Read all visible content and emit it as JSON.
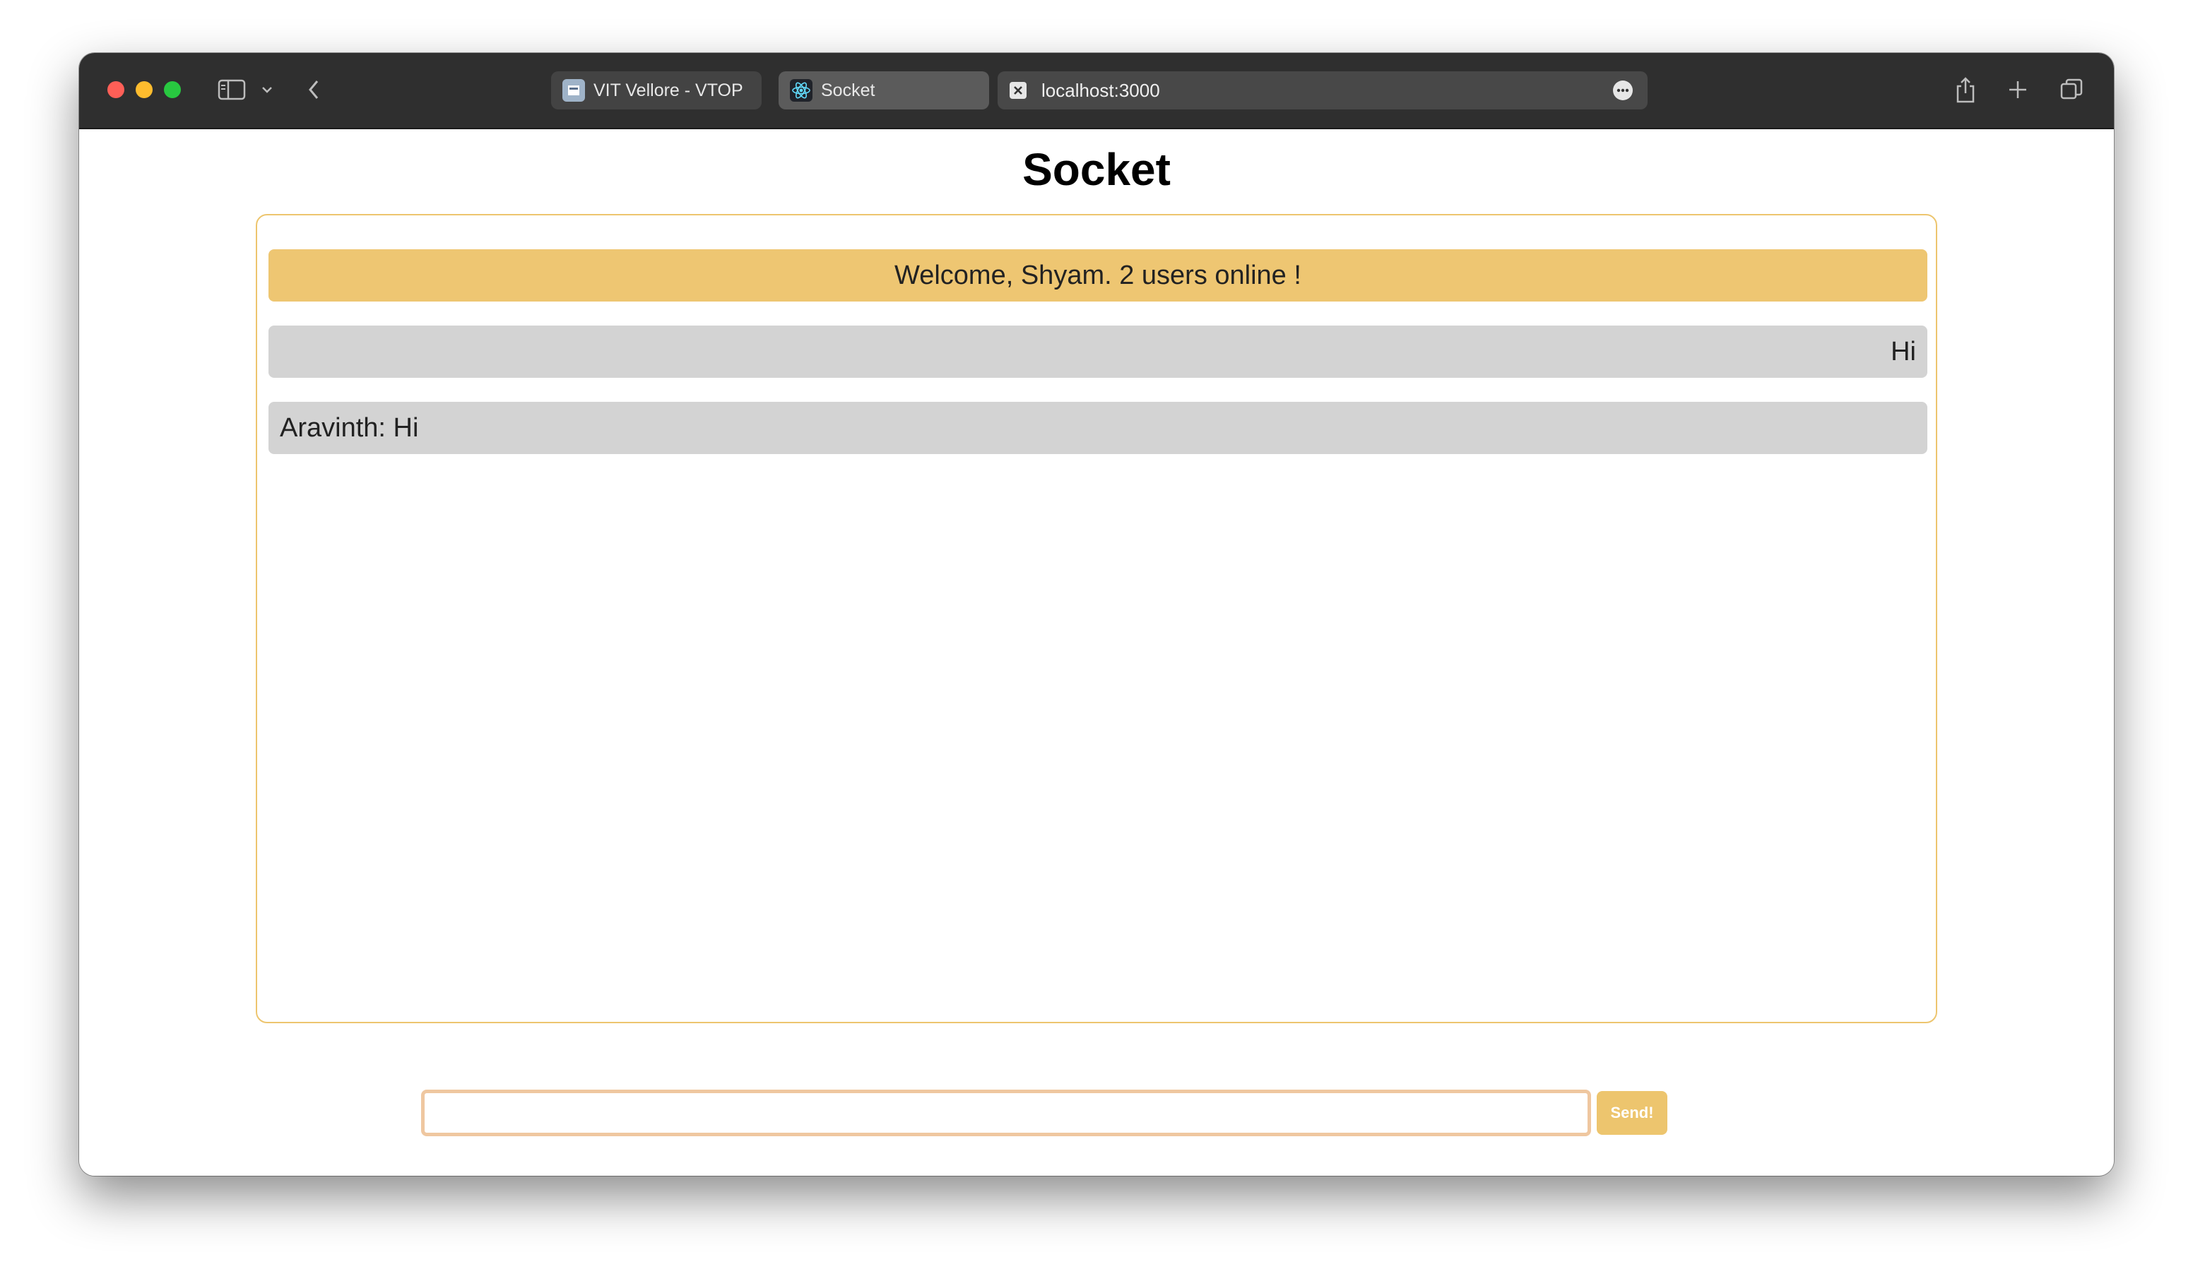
{
  "browser": {
    "tabs": [
      {
        "label": "VIT Vellore - VTOP",
        "active": false
      },
      {
        "label": "Socket",
        "active": true
      }
    ],
    "address": "localhost:3000"
  },
  "page": {
    "title": "Socket"
  },
  "chat": {
    "welcome": "Welcome, Shyam. 2 users online !",
    "messages": [
      {
        "text": "Hi",
        "side": "right"
      },
      {
        "text": "Aravinth: Hi",
        "side": "left"
      }
    ]
  },
  "composer": {
    "value": "",
    "send_label": "Send!"
  },
  "colors": {
    "accent": "#edc56e",
    "message_bg": "#d3d3d3"
  }
}
